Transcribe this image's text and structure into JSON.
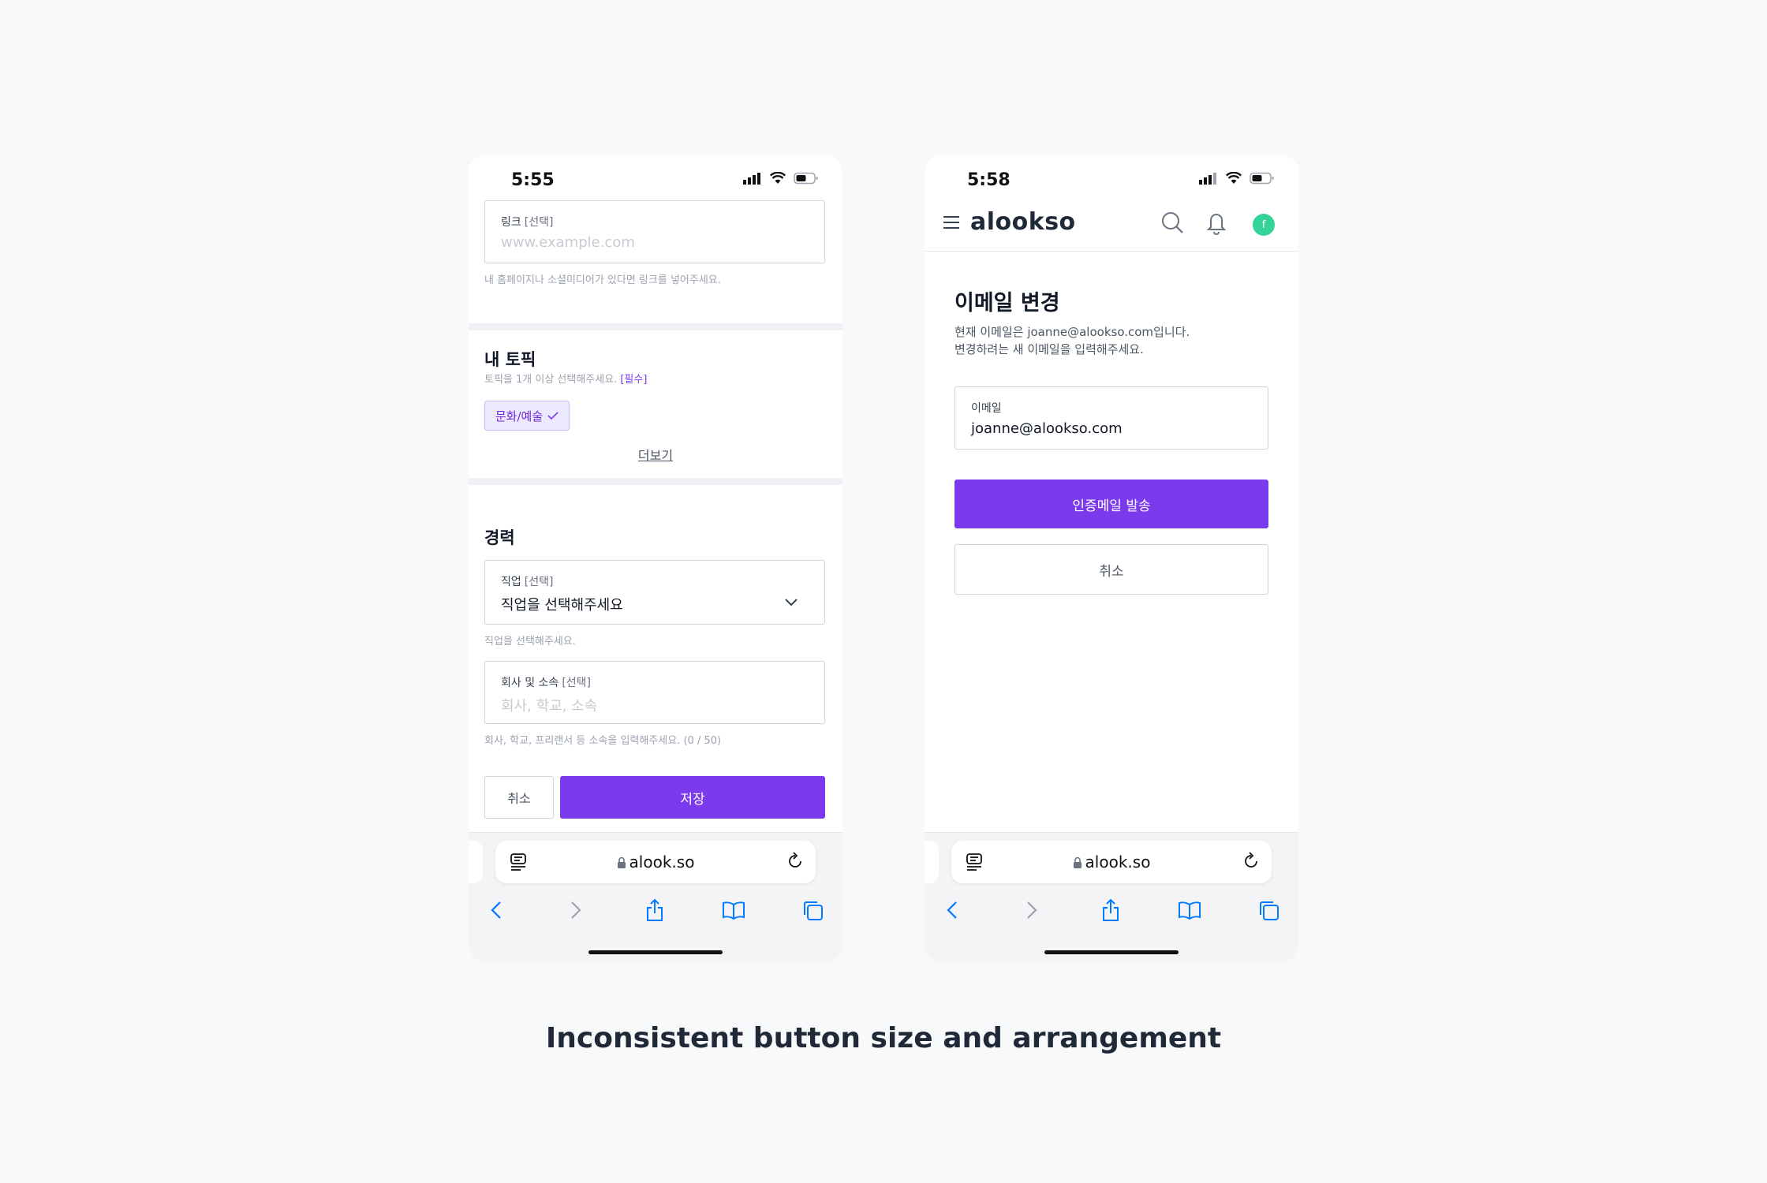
{
  "left_screen": {
    "status_time": "5:55",
    "link_field": {
      "label": "링크",
      "optional": "[선택]",
      "placeholder": "www.example.com",
      "helper": "내 홈페이지나 소셜미디어가 있다면 링크를 넣어주세요."
    },
    "topics": {
      "title": "내 토픽",
      "subtitle": "토픽을 1개 이상 선택해주세요.",
      "required": "[필수]",
      "chip_label": "문화/예술",
      "more_label": "더보기"
    },
    "career": {
      "title": "경력",
      "job_field": {
        "label": "직업",
        "optional": "[선택]",
        "value": "직업을 선택해주세요",
        "helper": "직업을 선택해주세요."
      },
      "company_field": {
        "label": "회사 및 소속",
        "optional": "[선택]",
        "placeholder": "회사, 학교, 소속",
        "helper": "회사, 학교, 프리랜서 등 소속을 입력해주세요. (0 / 50)"
      }
    },
    "buttons": {
      "cancel": "취소",
      "save": "저장"
    },
    "browser": {
      "url": "alook.so"
    }
  },
  "right_screen": {
    "status_time": "5:58",
    "header": {
      "logo": "alookso",
      "avatar_initial": "f"
    },
    "title": "이메일 변경",
    "description_line1": "현재 이메일은 joanne@alookso.com입니다.",
    "description_line2": "변경하려는 새 이메일을 입력해주세요.",
    "email_field": {
      "label": "이메일",
      "value": "joanne@alookso.com"
    },
    "buttons": {
      "send": "인증메일 발송",
      "cancel": "취소"
    },
    "browser": {
      "url": "alook.so"
    }
  },
  "caption": "Inconsistent button size and arrangement",
  "colors": {
    "primary": "#7c3aed",
    "chip_bg": "#ede9fe",
    "avatar": "#34d399",
    "ios_blue": "#007aff"
  },
  "icons": [
    "signal-icon",
    "wifi-icon",
    "battery-icon",
    "chevron-down-icon",
    "check-icon",
    "menu-icon",
    "search-icon",
    "bell-icon",
    "reader-icon",
    "lock-icon",
    "reload-icon",
    "back-icon",
    "forward-icon",
    "share-icon",
    "bookmarks-icon",
    "tabs-icon"
  ]
}
